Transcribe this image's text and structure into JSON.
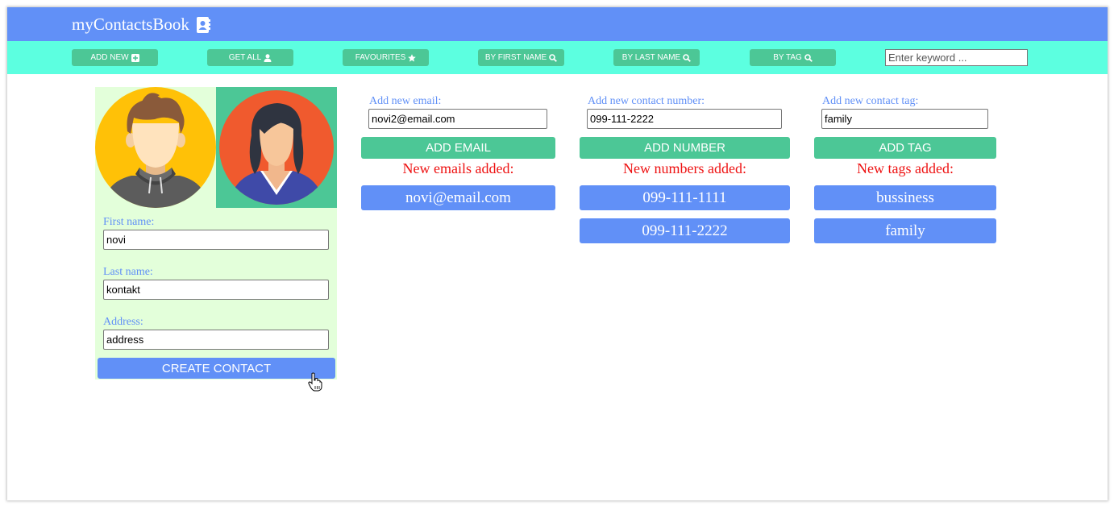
{
  "header": {
    "title": "myContactsBook",
    "icon": "address-book-icon"
  },
  "nav": {
    "add_new": "ADD NEW",
    "get_all": "GET ALL",
    "favourites": "FAVOURITES",
    "by_first_name": "BY FIRST NAME",
    "by_last_name": "BY LAST NAME",
    "by_tag": "BY TAG",
    "search_placeholder": "Enter keyword ..."
  },
  "contact_form": {
    "first_name_label": "First name:",
    "first_name_value": "novi",
    "last_name_label": "Last name:",
    "last_name_value": "kontakt",
    "address_label": "Address:",
    "address_value": "address",
    "create_button": "CREATE CONTACT"
  },
  "email": {
    "label": "Add new email:",
    "input_value": "novi2@email.com",
    "button": "ADD EMAIL",
    "added_heading": "New emails added:",
    "items": [
      "novi@email.com"
    ]
  },
  "number": {
    "label": "Add new contact number:",
    "input_value": "099-111-2222",
    "button": "ADD NUMBER",
    "added_heading": "New numbers added:",
    "items": [
      "099-111-1111",
      "099-111-2222"
    ]
  },
  "tag": {
    "label": "Add new contact tag:",
    "input_value": "family",
    "button": "ADD TAG",
    "added_heading": "New tags added:",
    "items": [
      "bussiness",
      "family"
    ]
  },
  "colors": {
    "header": "#6190f7",
    "navbar": "#5cffe0",
    "nav_button": "#4cc796",
    "card": "#e3ffda",
    "pill": "#6190f7",
    "heading_red": "#ee1111"
  }
}
